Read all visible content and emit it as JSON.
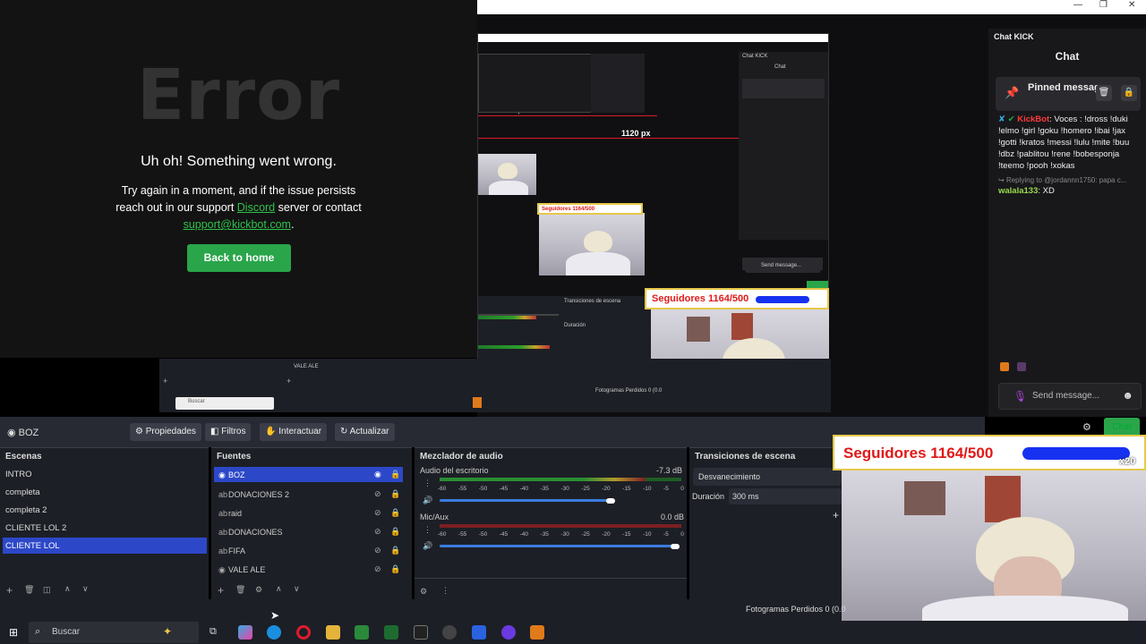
{
  "error_page": {
    "big_title": "Error",
    "headline": "Uh oh! Something went wrong.",
    "line1": "Try again in a moment, and if the issue persists",
    "line2a": "reach out in our support ",
    "discord": "Discord",
    "line2b": " server or contact",
    "email": "support@kickbot.com",
    "email_suffix": ".",
    "button": "Back to home"
  },
  "window": {
    "minimize": "—",
    "restore": "❐",
    "close": "✕"
  },
  "chat": {
    "title_label": "Chat KICK",
    "header": "Chat",
    "pinned_label": "Pinned message",
    "message1_user": "KickBot",
    "message1_text": ": Voces : !dross !duki !elmo !girl !goku !homero !ibai !jax !gotti !kratos !messi !lulu !mite !buu !dbz !pablitou !rene !bobesponja !teemo !pooh !xokas",
    "reply_to": "Replying to @jordannn1750: papa c...",
    "message2_user": "walala133",
    "message2_text": ": XD",
    "send_placeholder": "Send message...",
    "chat_button": "Chat"
  },
  "preview": {
    "px_small": "1120 px",
    "px_big": "1120 px"
  },
  "overlay": {
    "followers": "Seguidores 1164/500",
    "multiplier": "x20"
  },
  "obs": {
    "current_source": "BOZ",
    "toolbar": [
      "Propiedades",
      "Filtros",
      "Interactuar",
      "Actualizar"
    ],
    "scenes_header": "Escenas",
    "scenes": [
      "INTRO",
      "completa",
      "completa 2",
      "CLIENTE LOL 2",
      "CLIENTE LOL"
    ],
    "selected_scene": "CLIENTE LOL",
    "sources_header": "Fuentes",
    "sources": [
      "BOZ",
      "DONACIONES 2",
      "raid",
      "DONACIONES",
      "FIFA",
      "VALE ALE"
    ],
    "mixer_header": "Mezclador de audio",
    "desktop_audio": "Audio del escritorio",
    "desktop_db": "-7.3 dB",
    "mic_label": "Mic/Aux",
    "mic_db": "0.0 dB",
    "scale": [
      "-60",
      "-55",
      "-50",
      "-45",
      "-40",
      "-35",
      "-30",
      "-25",
      "-20",
      "-15",
      "-10",
      "-5",
      "0"
    ],
    "transitions_header": "Transiciones de escena",
    "transition": "Desvanecimiento",
    "duration_label": "Duración",
    "duration_value": "300 ms",
    "dropped_frames": "Fotogramas Perdidos 0 (0.0"
  },
  "taskbar": {
    "search_placeholder": "Buscar"
  },
  "colors": {
    "kick_green": "#2aa54a",
    "selection": "#2c48c8",
    "obs_bg": "#1d1f26"
  }
}
